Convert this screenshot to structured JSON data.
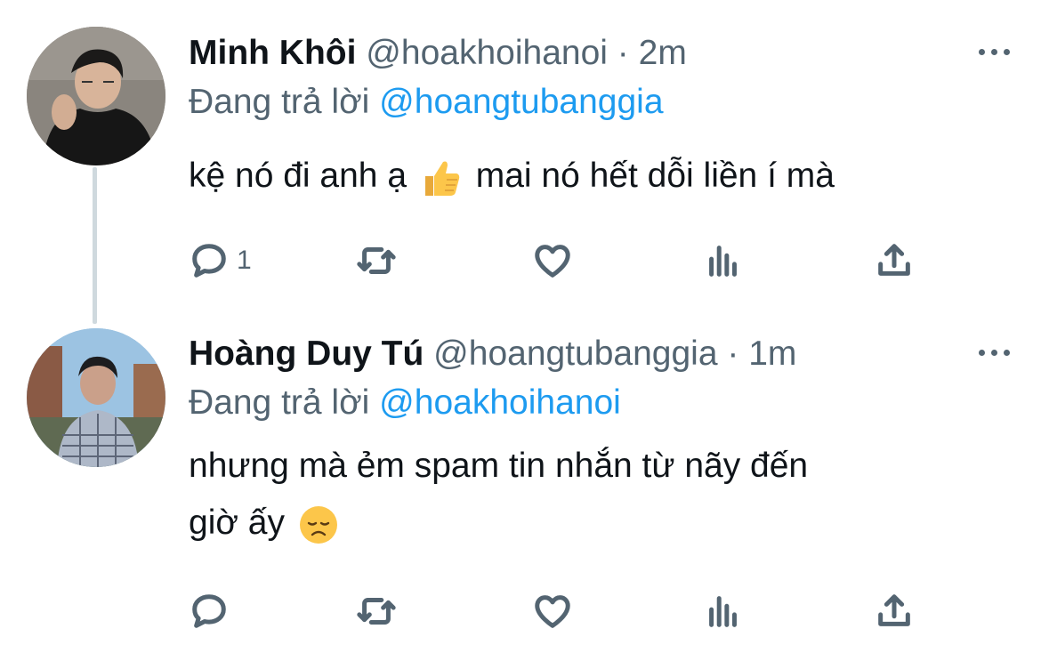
{
  "tweets": [
    {
      "name": "Minh Khôi",
      "handle": "@hoakhoihanoi",
      "separator": "·",
      "time": "2m",
      "reply_prefix": "Đang trả lời",
      "reply_to": "@hoangtubanggia",
      "text_before_emoji": "kệ nó đi anh ạ",
      "emoji": "thumbs-up",
      "text_after_emoji": "mai nó hết dỗi liền í mà",
      "reply_count": "1"
    },
    {
      "name": "Hoàng Duy Tú",
      "handle": "@hoangtubanggia",
      "separator": "·",
      "time": "1m",
      "reply_prefix": "Đang trả lời",
      "reply_to": "@hoakhoihanoi",
      "text_line1": "nhưng mà ẻm spam tin nhắn từ nãy đến",
      "text_line2": "giờ ấy",
      "emoji": "disappointed-face",
      "reply_count": ""
    }
  ],
  "colors": {
    "accent": "#1d9bf0",
    "muted": "#536471",
    "text": "#0f1419",
    "thread_line": "#cfd9de"
  }
}
